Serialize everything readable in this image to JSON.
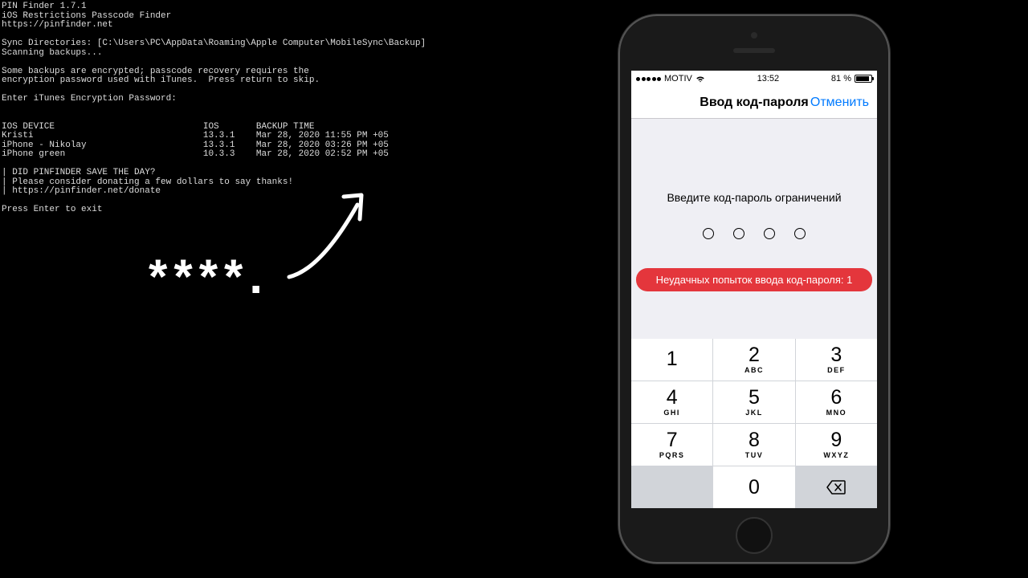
{
  "terminal": {
    "title": "PIN Finder 1.7.1",
    "subtitle": "iOS Restrictions Passcode Finder",
    "url": "https://pinfinder.net",
    "sync_line": "Sync Directories: [C:\\Users\\PC\\AppData\\Roaming\\Apple Computer\\MobileSync\\Backup]",
    "scanning": "Scanning backups...",
    "enc_msg1": "Some backups are encrypted; passcode recovery requires the",
    "enc_msg2": "encryption password used with iTunes.  Press return to skip.",
    "enter_pwd": "Enter iTunes Encryption Password:",
    "hdr_device": "IOS DEVICE",
    "hdr_ios": "IOS",
    "hdr_time": "BACKUP TIME",
    "rows": [
      {
        "device": "Kristi",
        "ios": "13.3.1",
        "time": "Mar 28, 2020 11:55 PM +05"
      },
      {
        "device": "iPhone - Nikolay",
        "ios": "13.3.1",
        "time": "Mar 28, 2020 03:26 PM +05"
      },
      {
        "device": "iPhone green",
        "ios": "10.3.3",
        "time": "Mar 28, 2020 02:52 PM +05"
      }
    ],
    "donate1": "| DID PINFINDER SAVE THE DAY?",
    "donate2": "| Please consider donating a few dollars to say thanks!",
    "donate3": "| https://pinfinder.net/donate",
    "exit": "Press Enter to exit"
  },
  "annotation": "****.",
  "phone": {
    "status": {
      "carrier": "MOTIV",
      "time": "13:52",
      "battery_pct": "81 %"
    },
    "nav": {
      "title": "Ввод код-пароля",
      "cancel": "Отменить"
    },
    "prompt": "Введите код-пароль ограничений",
    "error": "Неудачных попыток ввода код-пароля: 1",
    "keypad": {
      "k1": {
        "num": "1",
        "let": ""
      },
      "k2": {
        "num": "2",
        "let": "ABC"
      },
      "k3": {
        "num": "3",
        "let": "DEF"
      },
      "k4": {
        "num": "4",
        "let": "GHI"
      },
      "k5": {
        "num": "5",
        "let": "JKL"
      },
      "k6": {
        "num": "6",
        "let": "MNO"
      },
      "k7": {
        "num": "7",
        "let": "PQRS"
      },
      "k8": {
        "num": "8",
        "let": "TUV"
      },
      "k9": {
        "num": "9",
        "let": "WXYZ"
      },
      "k0": {
        "num": "0",
        "let": ""
      }
    }
  }
}
